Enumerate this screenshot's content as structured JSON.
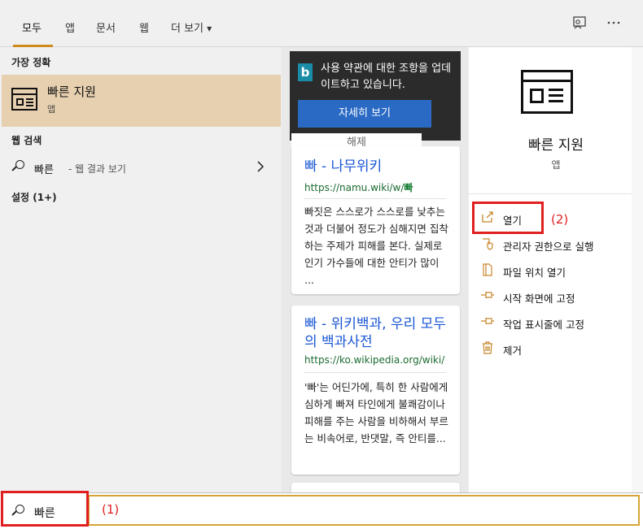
{
  "nav": {
    "tabs": [
      "모두",
      "앱",
      "문서",
      "웹",
      "더 보기"
    ],
    "more_arrow": "▾",
    "active_tab": "모두",
    "accent": "#d08a1b"
  },
  "left": {
    "best_match_header": "가장 정확",
    "best_match": {
      "title": "빠른 지원",
      "type": "앱"
    },
    "web_header": "웹 검색",
    "web_item": {
      "query": "빠른",
      "suffix": "- 웹 결과 보기"
    },
    "settings_header": "설정 (1+)"
  },
  "middle": {
    "bing": {
      "logo": "b",
      "message": "사용 약관에 대한 조항을 업데이트하고 있습니다.",
      "details_button": "자세히 보기",
      "dismiss": "해제"
    },
    "results": [
      {
        "title": "빠 - 나무위키",
        "url_prefix": "https://namu.wiki/w/",
        "url_bold": "빠",
        "snippet": "빠짓은 스스로가 스스로를 낮추는 것과 더불어 정도가 심해지면 집착하는 주제가 피해를 본다. 실제로 인기 가수들에 대한 안티가 많이 ..."
      },
      {
        "title": "빠 - 위키백과, 우리 모두의 백과사전",
        "url_prefix": "https://ko.wikipedia.org/wiki/",
        "url_bold": "",
        "snippet": "'빠'는 어딘가에, 특히 한 사람에게 심하게 빠져 타인에게 불쾌감이나 피해를 주는 사람을 비하해서 부르는 비속어로, 반댓말, 즉 안티를..."
      }
    ]
  },
  "right": {
    "app_name": "빠른 지원",
    "app_type": "앱",
    "actions": [
      {
        "label": "열기",
        "icon": "open-icon"
      },
      {
        "label": "관리자 권한으로 실행",
        "icon": "shield-icon"
      },
      {
        "label": "파일 위치 열기",
        "icon": "file-icon"
      },
      {
        "label": "시작 화면에 고정",
        "icon": "pin-icon"
      },
      {
        "label": "작업 표시줄에 고정",
        "icon": "pin-icon"
      },
      {
        "label": "제거",
        "icon": "trash-icon"
      }
    ]
  },
  "search": {
    "value": "빠른"
  },
  "annotations": {
    "label_1": "(1)",
    "label_2": "(2)",
    "color": "#e02020"
  }
}
